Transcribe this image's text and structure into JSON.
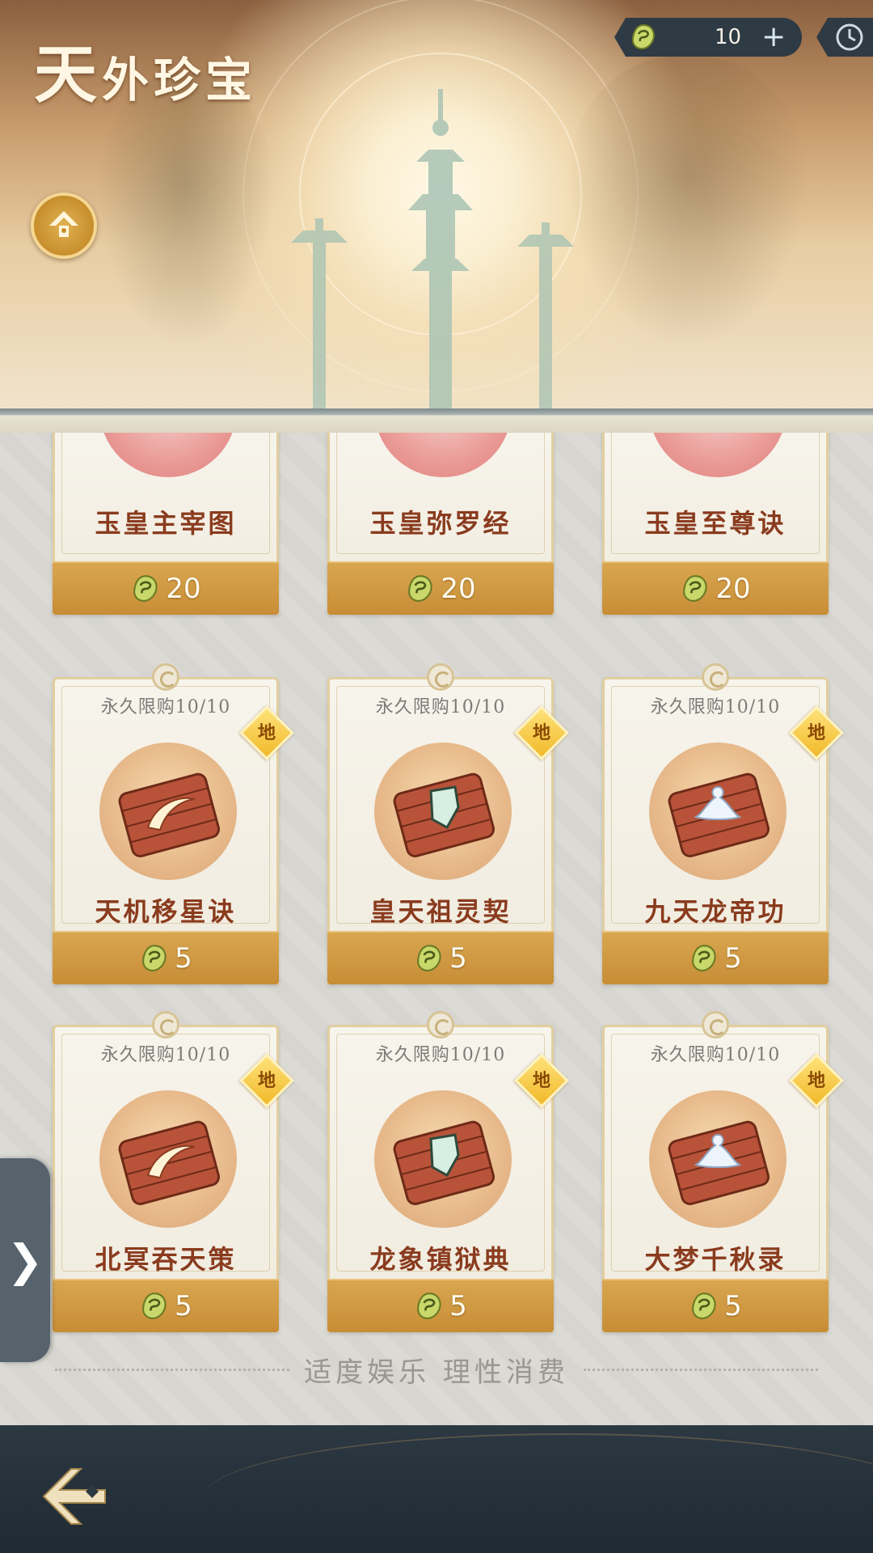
{
  "header": {
    "title_first": "天",
    "title_rest": "外珍宝"
  },
  "currency": {
    "amount": "10",
    "plus": "+",
    "icon": "jade-gem-icon"
  },
  "colors": {
    "price_bar": "#c78d36",
    "item_name": "#8a3b1e",
    "grade_badge": "#f1b92a",
    "top_bar": "#2e3a44"
  },
  "top_row": [
    {
      "name": "玉皇主宰图",
      "price": "20"
    },
    {
      "name": "玉皇弥罗经",
      "price": "20"
    },
    {
      "name": "玉皇至尊诀",
      "price": "20"
    }
  ],
  "row2": [
    {
      "limit": "永久限购10/10",
      "grade": "地",
      "name": "天机移星诀",
      "price": "5",
      "emblem": "slash"
    },
    {
      "limit": "永久限购10/10",
      "grade": "地",
      "name": "皇天祖灵契",
      "price": "5",
      "emblem": "shield"
    },
    {
      "limit": "永久限购10/10",
      "grade": "地",
      "name": "九天龙帝功",
      "price": "5",
      "emblem": "lotus"
    }
  ],
  "row3": [
    {
      "limit": "永久限购10/10",
      "grade": "地",
      "name": "北冥吞天策",
      "price": "5",
      "emblem": "slash"
    },
    {
      "limit": "永久限购10/10",
      "grade": "地",
      "name": "龙象镇狱典",
      "price": "5",
      "emblem": "shield"
    },
    {
      "limit": "永久限购10/10",
      "grade": "地",
      "name": "大梦千秋录",
      "price": "5",
      "emblem": "lotus"
    }
  ],
  "drawer": {
    "arrow": "❯"
  },
  "notice": "适度娱乐 理性消费"
}
